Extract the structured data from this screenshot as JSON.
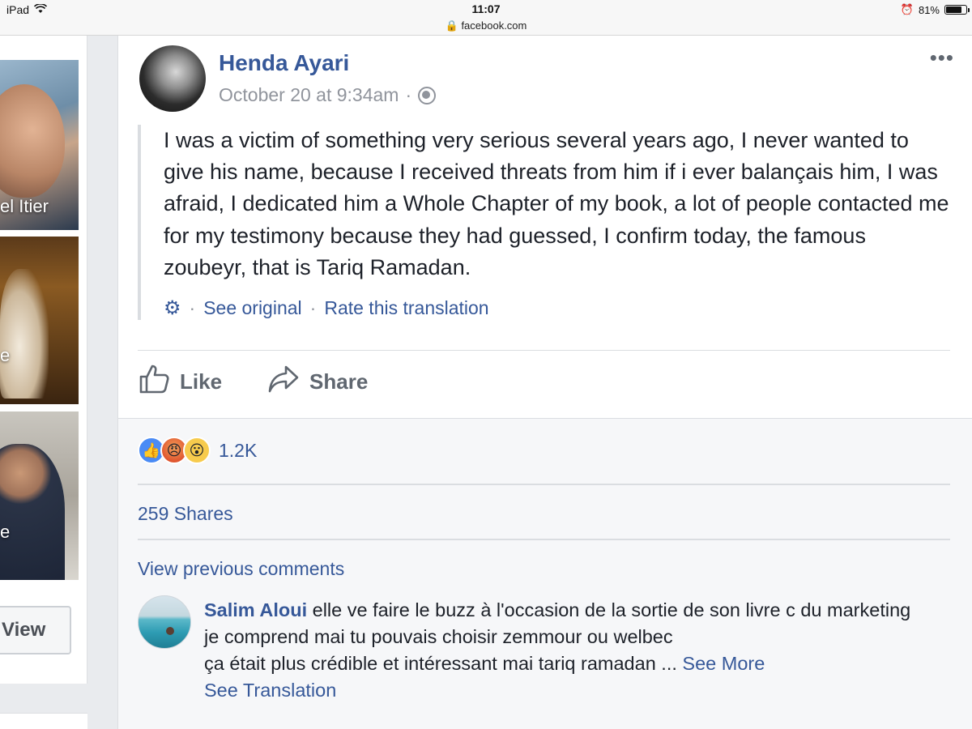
{
  "status_bar": {
    "device": "iPad",
    "time": "11:07",
    "url": "facebook.com",
    "battery": "81%",
    "battery_level": 0.81
  },
  "sidebar": {
    "cards": [
      {
        "label": "el Itier"
      },
      {
        "label": "e"
      },
      {
        "label": "e"
      }
    ],
    "view_button": "View"
  },
  "post": {
    "author": "Henda Ayari",
    "timestamp": "October 20 at 9:34am",
    "separator": "·",
    "more_icon": "•••",
    "body": "I was a victim of something very serious several years ago, I never wanted to give his name, because I received threats from him if i ever balançais him, I was afraid, I dedicated him a Whole Chapter of my book, a lot of people contacted me for my testimony because they had guessed, I confirm today, the famous zoubeyr, that is Tariq Ramadan.",
    "translation": {
      "see_original": "See original",
      "rate": "Rate this translation"
    },
    "actions": {
      "like": "Like",
      "share": "Share"
    },
    "reactions_count": "1.2K",
    "shares": "259 Shares",
    "view_previous": "View previous comments"
  },
  "comment": {
    "author": "Salim Aloui",
    "line1": "elle ve faire le buzz à l'occasion de la sortie de son livre c du marketing",
    "line2": "je comprend mai tu pouvais choisir zemmour ou welbec",
    "line3": "ça était plus crédible et intéressant mai tariq ramadan ...",
    "see_more": "See More",
    "see_translation": "See Translation"
  },
  "colors": {
    "link": "#365899",
    "muted": "#90949c",
    "text": "#1d2129",
    "background": "#e9ebee"
  }
}
